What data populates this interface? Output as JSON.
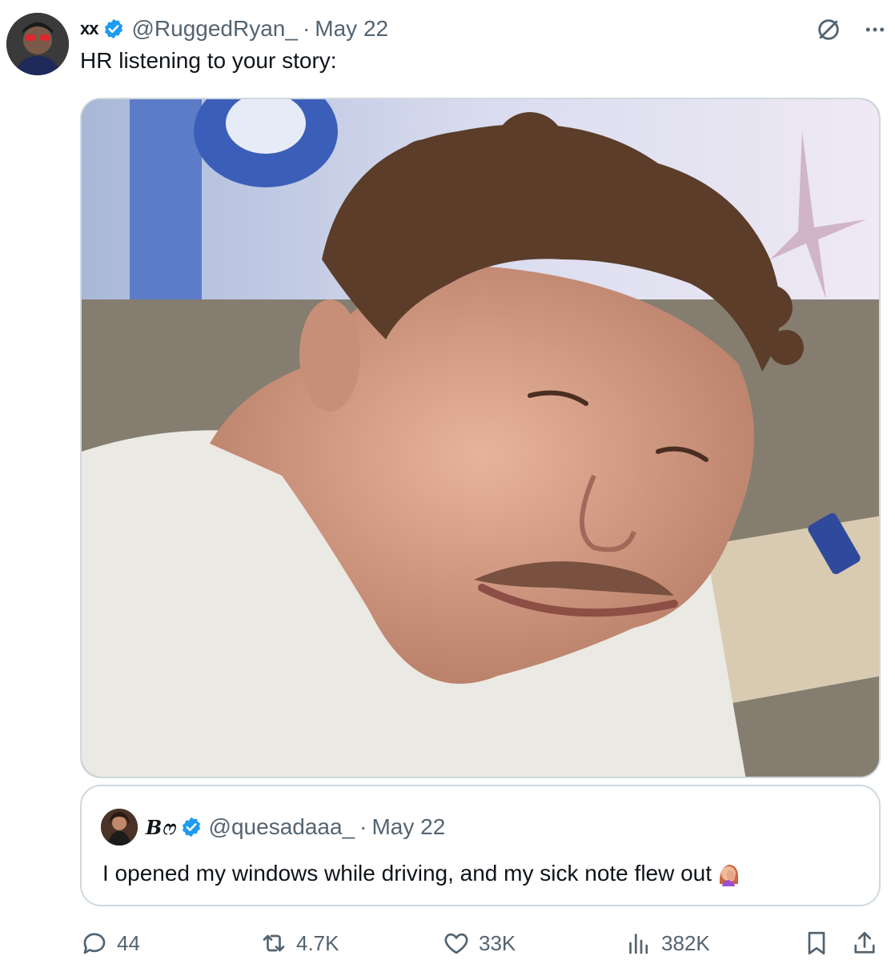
{
  "post": {
    "display_name": "xx",
    "handle": "@RuggedRyan_",
    "separator": "·",
    "date": "May 22",
    "text": "HR listening to your story:"
  },
  "quote": {
    "display_name": "Bෆ",
    "handle": "@quesadaaa_",
    "separator": "·",
    "date": "May 22",
    "text": "I opened my windows while driving, and my sick note flew out"
  },
  "actions": {
    "replies": "44",
    "reposts": "4.7K",
    "likes": "33K",
    "views": "382K"
  },
  "icons": [
    "grok-icon",
    "more-icon",
    "reply-icon",
    "repost-icon",
    "like-icon",
    "views-icon",
    "bookmark-icon",
    "share-icon",
    "verified-badge-icon",
    "facepalm-emoji-icon"
  ],
  "colors": {
    "text": "#0f1419",
    "secondary": "#536471",
    "verified": "#1d9bf0",
    "border": "#cfd9de"
  }
}
